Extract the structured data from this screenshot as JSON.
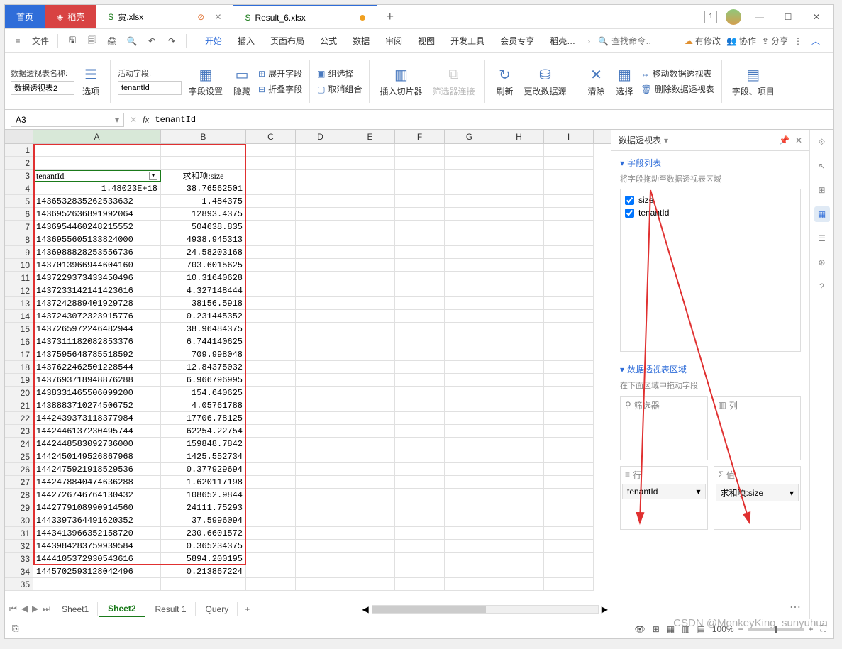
{
  "titlebar": {
    "home": "首页",
    "dao": "稻壳",
    "file1": "贾.xlsx",
    "file2": "Result_6.xlsx",
    "boxnum": "1"
  },
  "menubar": {
    "file": "文件",
    "tabs": [
      "开始",
      "插入",
      "页面布局",
      "公式",
      "数据",
      "审阅",
      "视图",
      "开发工具",
      "会员专享",
      "稻壳…"
    ],
    "search_ph": "查找命令…",
    "tools": {
      "undo": "有修改",
      "coop": "协作",
      "share": "分享"
    }
  },
  "ribbon": {
    "pt_name_label": "数据透视表名称:",
    "pt_name": "数据透视表2",
    "options": "选项",
    "active_field_label": "活动字段:",
    "active_field": "tenantId",
    "field_settings": "字段设置",
    "hide": "隐藏",
    "expand": "展开字段",
    "collapse": "折叠字段",
    "group_sel": "组选择",
    "ungroup": "取消组合",
    "slicer": "插入切片器",
    "filter_conn": "筛选器连接",
    "refresh": "刷新",
    "change_src": "更改数据源",
    "clear": "清除",
    "select": "选择",
    "move_pt": "移动数据透视表",
    "del_pt": "删除数据透视表",
    "fields_items": "字段、项目"
  },
  "formulabar": {
    "namebox": "A3",
    "value": "tenantId"
  },
  "grid": {
    "cols": [
      "A",
      "B",
      "C",
      "D",
      "E",
      "F",
      "G",
      "H",
      "I"
    ],
    "widths": [
      180,
      120,
      70,
      70,
      70,
      70,
      70,
      70,
      70,
      70
    ],
    "header": [
      "tenantId",
      "求和项:size"
    ],
    "rows": [
      [
        "1.48023E+18",
        "38.76562501"
      ],
      [
        "1436532835262533632",
        "1.484375"
      ],
      [
        "1436952636891992064",
        "12893.4375"
      ],
      [
        "1436954460248215552",
        "504638.835"
      ],
      [
        "1436955605133824000",
        "4938.945313"
      ],
      [
        "1436988828253556736",
        "24.58203168"
      ],
      [
        "1437013966944604160",
        "703.6015625"
      ],
      [
        "1437229373433450496",
        "10.31640628"
      ],
      [
        "1437233142141423616",
        "4.327148444"
      ],
      [
        "1437242889401929728",
        "38156.5918"
      ],
      [
        "1437243072323915776",
        "0.231445352"
      ],
      [
        "1437265972246482944",
        "38.96484375"
      ],
      [
        "1437311182082853376",
        "6.744140625"
      ],
      [
        "1437595648785518592",
        "709.998048"
      ],
      [
        "1437622462501228544",
        "12.84375032"
      ],
      [
        "1437693718948876288",
        "6.966796995"
      ],
      [
        "1438331465506099200",
        "154.640625"
      ],
      [
        "1438883710274506752",
        "4.05761788"
      ],
      [
        "1442439373118377984",
        "17706.78125"
      ],
      [
        "1442446137230495744",
        "62254.22754"
      ],
      [
        "1442448583092736000",
        "159848.7842"
      ],
      [
        "1442450149526867968",
        "1425.552734"
      ],
      [
        "1442475921918529536",
        "0.377929694"
      ],
      [
        "1442478840474636288",
        "1.620117198"
      ],
      [
        "1442726746764130432",
        "108652.9844"
      ],
      [
        "1442779108990914560",
        "24111.75293"
      ],
      [
        "1443397364491620352",
        "37.5996094"
      ],
      [
        "1443413966352158720",
        "230.6601572"
      ],
      [
        "1443984283759939584",
        "0.365234375"
      ],
      [
        "1444105372930543616",
        "5894.200195"
      ],
      [
        "1445702593128042496",
        "0.213867224"
      ]
    ]
  },
  "sheets": [
    "Sheet1",
    "Sheet2",
    "Result 1",
    "Query"
  ],
  "active_sheet": "Sheet2",
  "panel": {
    "title": "数据透视表",
    "field_list": "字段列表",
    "field_hint": "将字段拖动至数据透视表区域",
    "fields": [
      "size",
      "tenantId"
    ],
    "area_title": "数据透视表区域",
    "area_hint": "在下面区域中拖动字段",
    "filter": "筛选器",
    "col": "列",
    "row": "行",
    "val": "值",
    "row_item": "tenantId",
    "val_item": "求和项:size"
  },
  "status": {
    "zoom": "100%"
  },
  "watermark": "CSDN @MonkeyKing_sunyuhua"
}
